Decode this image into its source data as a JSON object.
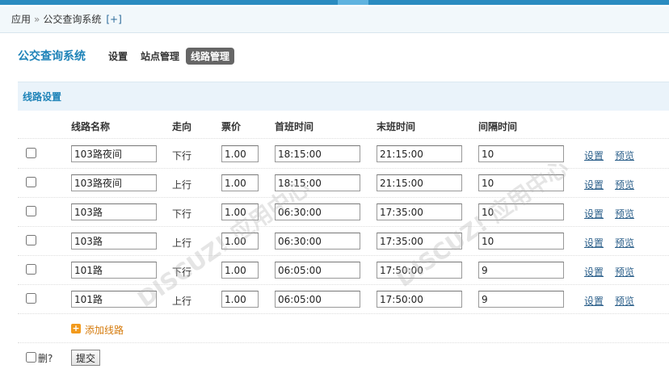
{
  "breadcrumb": {
    "root": "应用",
    "sep": "»",
    "current": "公交查询系统",
    "add": "[+]"
  },
  "header": {
    "title": "公交查询系统",
    "nav": [
      {
        "label": "设置",
        "active": false
      },
      {
        "label": "站点管理",
        "active": false
      },
      {
        "label": "线路管理",
        "active": true
      }
    ]
  },
  "section_title": "线路设置",
  "columns": [
    "线路名称",
    "走向",
    "票价",
    "首班时间",
    "末班时间",
    "间隔时间"
  ],
  "routes": [
    {
      "name": "103路夜间",
      "direction": "下行",
      "fare": "1.00",
      "first": "18:15:00",
      "last": "21:15:00",
      "interval": "10",
      "edit": "设置",
      "preview": "预览"
    },
    {
      "name": "103路夜间",
      "direction": "上行",
      "fare": "1.00",
      "first": "18:15:00",
      "last": "21:15:00",
      "interval": "10",
      "edit": "设置",
      "preview": "预览"
    },
    {
      "name": "103路",
      "direction": "下行",
      "fare": "1.00",
      "first": "06:30:00",
      "last": "17:35:00",
      "interval": "10",
      "edit": "设置",
      "preview": "预览"
    },
    {
      "name": "103路",
      "direction": "上行",
      "fare": "1.00",
      "first": "06:30:00",
      "last": "17:35:00",
      "interval": "10",
      "edit": "设置",
      "preview": "预览"
    },
    {
      "name": "101路",
      "direction": "下行",
      "fare": "1.00",
      "first": "06:05:00",
      "last": "17:50:00",
      "interval": "9",
      "edit": "设置",
      "preview": "预览"
    },
    {
      "name": "101路",
      "direction": "上行",
      "fare": "1.00",
      "first": "06:05:00",
      "last": "17:50:00",
      "interval": "9",
      "edit": "设置",
      "preview": "预览"
    }
  ],
  "add_route": "添加线路",
  "delete_label": "删?",
  "submit_label": "提交",
  "icons": {
    "add": "plus-square-icon"
  },
  "colors": {
    "accent": "#1e83b8",
    "topbar": "#2a8bc0",
    "section_bg": "#eaf3fa",
    "add_icon": "#f29a1c"
  }
}
